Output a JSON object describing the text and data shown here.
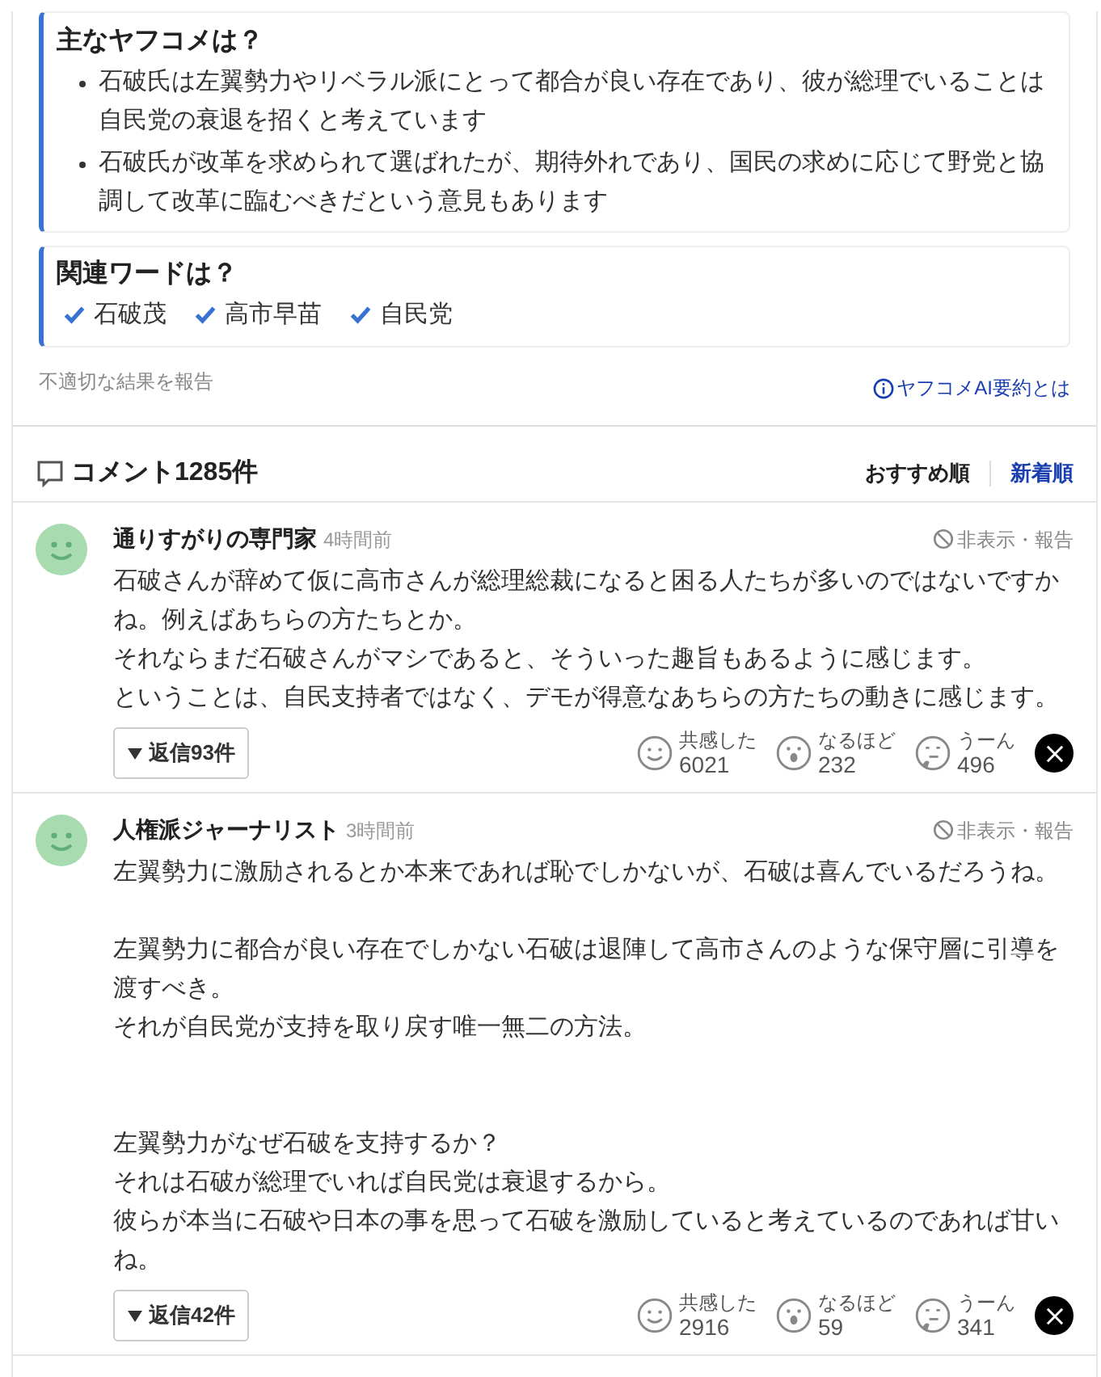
{
  "summary": {
    "title": "主なヤフコメは？",
    "points": [
      "石破氏は左翼勢力やリベラル派にとって都合が良い存在であり、彼が総理でいることは自民党の衰退を招くと考えています",
      "石破氏が改革を求められて選ばれたが、期待外れであり、国民の求めに応じて野党と協調して改革に臨むべきだという意見もあります"
    ]
  },
  "related": {
    "title": "関連ワードは？",
    "words": [
      "石破茂",
      "高市早苗",
      "自民党"
    ]
  },
  "report_link": "不適切な結果を報告",
  "about_link": "ヤフコメAI要約とは",
  "comments_header": {
    "title": "コメント1285件",
    "sort": [
      {
        "label": "おすすめ順",
        "selected": true
      },
      {
        "label": "新着順",
        "selected": false
      }
    ]
  },
  "comments": [
    {
      "author": "通りすがりの専門家",
      "time": "4時間前",
      "hide_report": "非表示・報告",
      "body": [
        {
          "kind": "line",
          "text": "石破さんが辞めて仮に高市さんが総理総裁になると困る人たちが多いのではないですかね。例えばあちらの方たちとか。"
        },
        {
          "kind": "line",
          "text": "それならまだ石破さんがマシであると、そういった趣旨もあるように感じます。"
        },
        {
          "kind": "line",
          "text": "ということは、自民支持者ではなく、デモが得意なあちらの方たちの動きに感じます。"
        }
      ],
      "replies": "返信93件",
      "reactions": [
        {
          "kind": "smile",
          "label": "共感した",
          "count": "6021"
        },
        {
          "kind": "surprise",
          "label": "なるほど",
          "count": "232"
        },
        {
          "kind": "think",
          "label": "うーん",
          "count": "496"
        }
      ]
    },
    {
      "author": "人権派ジャーナリスト",
      "time": "3時間前",
      "hide_report": "非表示・報告",
      "body": [
        {
          "kind": "line",
          "text": "左翼勢力に激励されるとか本来であれば恥でしかないが、石破は喜んでいるだろうね。"
        },
        {
          "kind": "blank"
        },
        {
          "kind": "line",
          "text": "左翼勢力に都合が良い存在でしかない石破は退陣して高市さんのような保守層に引導を渡すべき。"
        },
        {
          "kind": "line",
          "text": "それが自民党が支持を取り戻す唯一無二の方法。"
        },
        {
          "kind": "blank"
        },
        {
          "kind": "blank"
        },
        {
          "kind": "line",
          "text": "左翼勢力がなぜ石破を支持するか？"
        },
        {
          "kind": "line",
          "text": "それは石破が総理でいれば自民党は衰退するから。"
        },
        {
          "kind": "line",
          "text": "彼らが本当に石破や日本の事を思って石破を激励していると考えているのであれば甘いね。"
        }
      ],
      "replies": "返信42件",
      "reactions": [
        {
          "kind": "smile",
          "label": "共感した",
          "count": "2916"
        },
        {
          "kind": "surprise",
          "label": "なるほど",
          "count": "59"
        },
        {
          "kind": "think",
          "label": "うーん",
          "count": "341"
        }
      ]
    }
  ]
}
